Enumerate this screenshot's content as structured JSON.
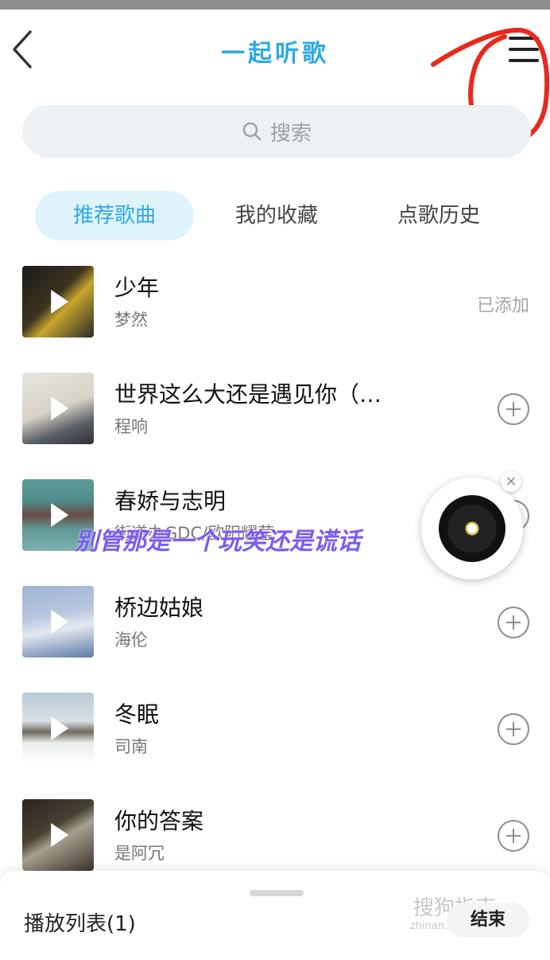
{
  "header": {
    "title": "一起听歌"
  },
  "search": {
    "placeholder": "搜索"
  },
  "tabs": [
    "推荐歌曲",
    "我的收藏",
    "点歌历史"
  ],
  "songs": [
    {
      "title": "少年",
      "artist": "梦然",
      "status": "已添加"
    },
    {
      "title": "世界这么大还是遇见你（…",
      "artist": "程响",
      "status": ""
    },
    {
      "title": "春娇与志明",
      "artist": "街道办GDC/欧阳耀莹",
      "status": ""
    },
    {
      "title": "桥边姑娘",
      "artist": "海伦",
      "status": ""
    },
    {
      "title": "冬眠",
      "artist": "司南",
      "status": ""
    },
    {
      "title": "你的答案",
      "artist": "是阿冗",
      "status": ""
    }
  ],
  "overlay": {
    "caption": "别管那是一个玩笑还是谎话"
  },
  "bottom_bar": {
    "playlist_label": "播放列表(1)",
    "end_label": "结束"
  },
  "watermark": {
    "text": "搜狗指南",
    "subtext": "zhinan.sogou.com"
  },
  "colors": {
    "accent": "#2fa9e4",
    "annotation": "#e8291c",
    "caption": "#7a5cf0"
  }
}
